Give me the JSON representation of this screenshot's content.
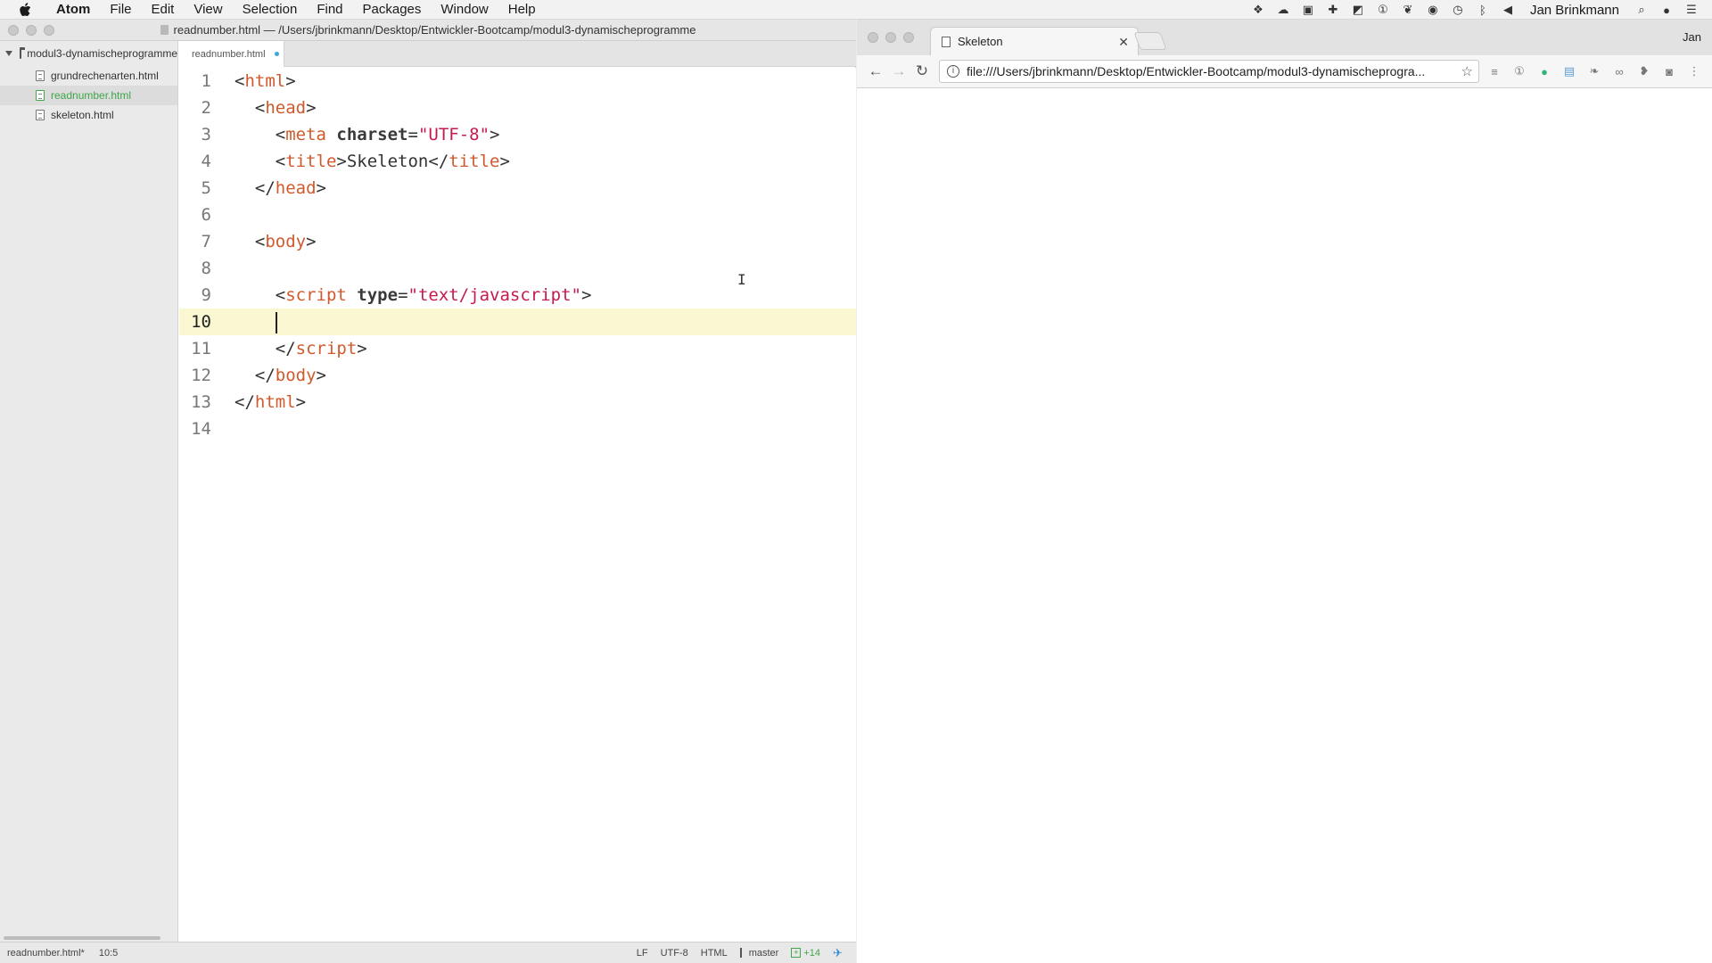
{
  "menubar": {
    "items": [
      "Atom",
      "File",
      "Edit",
      "View",
      "Selection",
      "Find",
      "Packages",
      "Window",
      "Help"
    ],
    "user": "Jan Brinkmann"
  },
  "atom": {
    "title": "readnumber.html — /Users/jbrinkmann/Desktop/Entwickler-Bootcamp/modul3-dynamischeprogramme",
    "tree": {
      "root": "modul3-dynamischeprogramme",
      "files": [
        "grundrechenarten.html",
        "readnumber.html",
        "skeleton.html"
      ],
      "active": "readnumber.html"
    },
    "tab": {
      "label": "readnumber.html"
    },
    "lines": [
      "1",
      "2",
      "3",
      "4",
      "5",
      "6",
      "7",
      "8",
      "9",
      "10",
      "11",
      "12",
      "13",
      "14"
    ],
    "code": {
      "html_open": "html",
      "head_open": "head",
      "meta_tag": "meta",
      "meta_attr": "charset",
      "meta_val": "\"UTF-8\"",
      "title_tag": "title",
      "title_text": "Skeleton",
      "head_close": "head",
      "body_open": "body",
      "script_tag": "script",
      "script_attr": "type",
      "script_val": "\"text/javascript\"",
      "script_close": "script",
      "body_close": "body",
      "html_close": "html"
    },
    "status": {
      "file": "readnumber.html*",
      "cursor": "10:5",
      "line_ending": "LF",
      "encoding": "UTF-8",
      "grammar": "HTML",
      "branch": "master",
      "diff": "+14"
    }
  },
  "chrome": {
    "tab_title": "Skeleton",
    "profile": "Jan",
    "url": "file:///Users/jbrinkmann/Desktop/Entwickler-Bootcamp/modul3-dynamischeprogra..."
  }
}
